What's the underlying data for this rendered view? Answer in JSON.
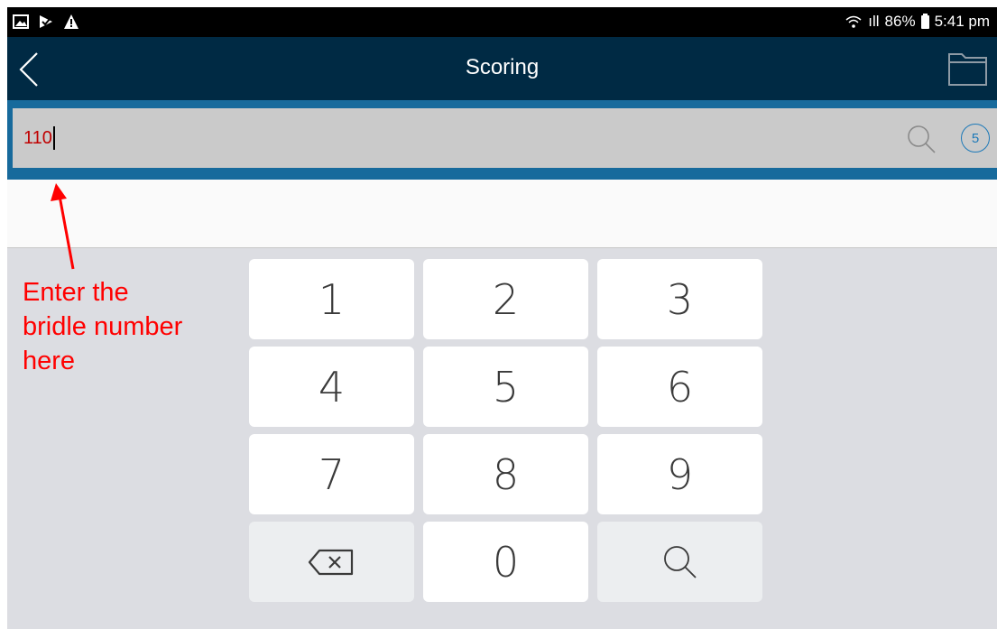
{
  "status_bar": {
    "left_icons": [
      "image-icon",
      "check-flag-icon",
      "alert-triangle-icon"
    ],
    "signal": "ıll",
    "battery_percent": "86%",
    "time": "5:41 pm"
  },
  "app_bar": {
    "title": "Scoring",
    "back_icon": "chevron-left-icon",
    "right_icon": "folder-icon"
  },
  "search": {
    "value": "110",
    "count": "5"
  },
  "keypad": {
    "keys": [
      "1",
      "2",
      "3",
      "4",
      "5",
      "6",
      "7",
      "8",
      "9"
    ],
    "zero": "0",
    "backspace_icon": "backspace-icon",
    "search_icon": "search-icon"
  },
  "annotation": {
    "text": "Enter the\nbridle number\nhere"
  },
  "colors": {
    "app_bar": "#002a44",
    "search_band": "#176a9c",
    "input_text": "#c00000",
    "annotation": "#ff0000",
    "badge": "#1d79b8"
  }
}
